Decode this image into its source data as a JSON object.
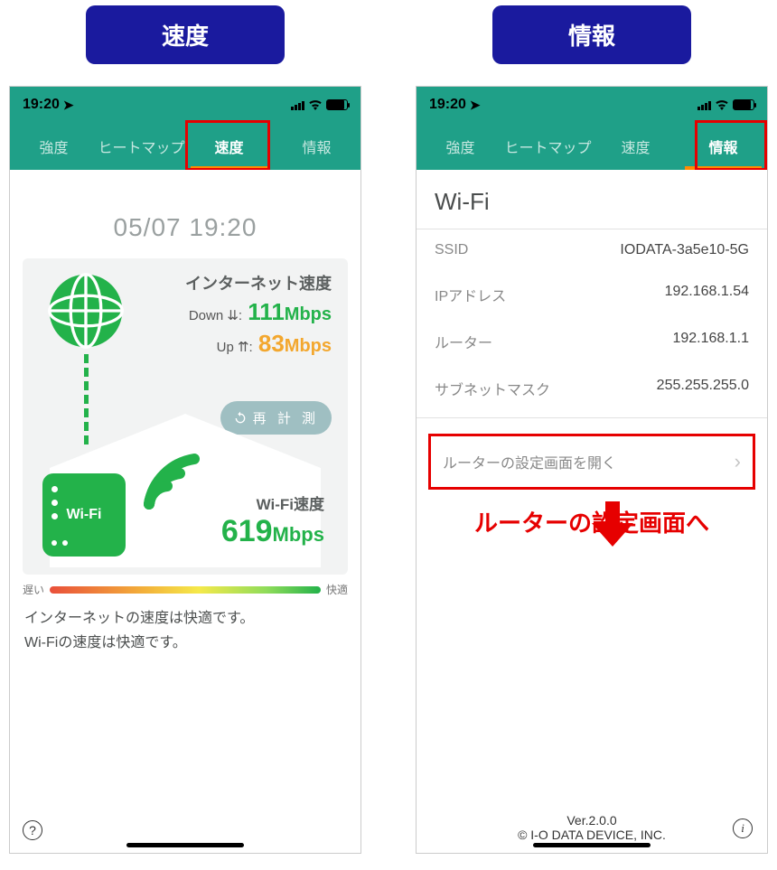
{
  "titles": {
    "speed": "速度",
    "info": "情報"
  },
  "statusbar": {
    "time": "19:20"
  },
  "tabs": {
    "t1": "強度",
    "t2": "ヒートマップ",
    "t3": "速度",
    "t4": "情報"
  },
  "speed": {
    "timestamp": "05/07 19:20",
    "internet_title": "インターネット速度",
    "down_label": "Down ⇊:",
    "down_value": "111",
    "up_label": "Up ⇈:",
    "up_value": "83",
    "unit": "Mbps",
    "remeasure": "再 計 測",
    "wifi_title": "Wi-Fi速度",
    "wifi_value": "619",
    "router_label": "Wi-Fi",
    "legend_slow": "遅い",
    "legend_fast": "快適",
    "summary_line1": "インターネットの速度は快適です。",
    "summary_line2": "Wi-Fiの速度は快適です。"
  },
  "info": {
    "section_title": "Wi-Fi",
    "ssid_k": "SSID",
    "ssid_v": "IODATA-3a5e10-5G",
    "ip_k": "IPアドレス",
    "ip_v": "192.168.1.54",
    "router_k": "ルーター",
    "router_v": "192.168.1.1",
    "subnet_k": "サブネットマスク",
    "subnet_v": "255.255.255.0",
    "open_router": "ルーターの設定画面を開く",
    "red_caption": "ルーターの設定画面へ",
    "version": "Ver.2.0.0",
    "copyright": "© I-O DATA DEVICE, INC."
  }
}
